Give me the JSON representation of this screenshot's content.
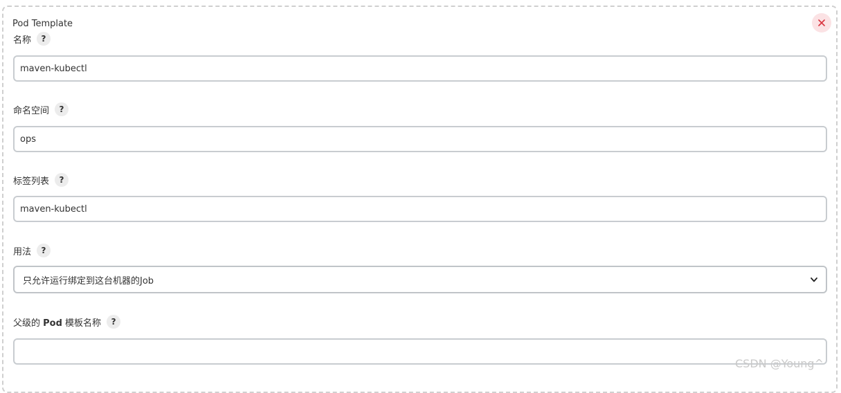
{
  "panel": {
    "title": "Pod Template"
  },
  "fields": {
    "name": {
      "label": "名称",
      "value": "maven-kubectl"
    },
    "namespace": {
      "label": "命名空间",
      "value": "ops"
    },
    "labels": {
      "label": "标签列表",
      "value": "maven-kubectl"
    },
    "usage": {
      "label": "用法",
      "selected": "只允许运行绑定到这台机器的Job"
    },
    "parent": {
      "label_prefix": "父级的 ",
      "label_strong": "Pod",
      "label_suffix": " 模板名称",
      "value": ""
    }
  },
  "help_glyph": "?",
  "watermark": "CSDN @Young^",
  "icons": {
    "close": "close-icon",
    "dropdown": "chevron-down-icon"
  },
  "colors": {
    "close_bg": "#fbe2e4",
    "close_fg": "#d9343f",
    "border_dashed": "#cfcfcf"
  }
}
